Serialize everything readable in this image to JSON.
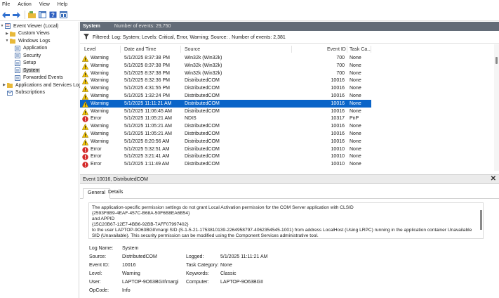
{
  "menu": [
    "File",
    "Action",
    "View",
    "Help"
  ],
  "toolbar": {
    "icons": [
      "back-arrow-icon",
      "forward-arrow-icon",
      "folder-icon",
      "console-tree-icon",
      "help-icon",
      "properties-icon"
    ]
  },
  "tree": {
    "items": [
      {
        "label": "Event Viewer (Local)",
        "icon": "event-viewer-icon"
      },
      {
        "label": "Custom Views",
        "icon": "folder-icon"
      },
      {
        "label": "Windows Logs",
        "icon": "folder-icon"
      },
      {
        "label": "Application",
        "icon": "log-icon"
      },
      {
        "label": "Security",
        "icon": "log-icon"
      },
      {
        "label": "Setup",
        "icon": "log-icon"
      },
      {
        "label": "System",
        "icon": "log-icon"
      },
      {
        "label": "Forwarded Events",
        "icon": "log-icon"
      },
      {
        "label": "Applications and Services Logs",
        "icon": "folder-icon"
      },
      {
        "label": "Subscriptions",
        "icon": "subscriptions-icon"
      }
    ]
  },
  "pane": {
    "title": "System",
    "count": "Number of events: 29,750",
    "filter": "Filtered: Log: System; Levels: Critical, Error, Warning; Source: . Number of events: 2,381"
  },
  "grid": {
    "headers": [
      "Level",
      "Date and Time",
      "Source",
      "Event ID",
      "Task Ca..."
    ],
    "rows": [
      {
        "level": "Warning",
        "date": "5/1/2025 8:37:38 PM",
        "source": "Win32k (Win32k)",
        "id": "700",
        "task": "None"
      },
      {
        "level": "Warning",
        "date": "5/1/2025 8:37:38 PM",
        "source": "Win32k (Win32k)",
        "id": "700",
        "task": "None"
      },
      {
        "level": "Warning",
        "date": "5/1/2025 8:37:38 PM",
        "source": "Win32k (Win32k)",
        "id": "700",
        "task": "None"
      },
      {
        "level": "Warning",
        "date": "5/1/2025 8:32:36 PM",
        "source": "DistributedCOM",
        "id": "10016",
        "task": "None"
      },
      {
        "level": "Warning",
        "date": "5/1/2025 4:31:55 PM",
        "source": "DistributedCOM",
        "id": "10016",
        "task": "None"
      },
      {
        "level": "Warning",
        "date": "5/1/2025 1:32:24 PM",
        "source": "DistributedCOM",
        "id": "10016",
        "task": "None"
      },
      {
        "level": "Warning",
        "date": "5/1/2025 11:11:21 AM",
        "source": "DistributedCOM",
        "id": "10016",
        "task": "None",
        "selected": true
      },
      {
        "level": "Warning",
        "date": "5/1/2025 11:06:45 AM",
        "source": "DistributedCOM",
        "id": "10016",
        "task": "None"
      },
      {
        "level": "Error",
        "date": "5/1/2025 11:05:21 AM",
        "source": "NDIS",
        "id": "10317",
        "task": "PnP"
      },
      {
        "level": "Warning",
        "date": "5/1/2025 11:05:21 AM",
        "source": "DistributedCOM",
        "id": "10016",
        "task": "None"
      },
      {
        "level": "Warning",
        "date": "5/1/2025 11:05:21 AM",
        "source": "DistributedCOM",
        "id": "10016",
        "task": "None"
      },
      {
        "level": "Warning",
        "date": "5/1/2025 8:20:56 AM",
        "source": "DistributedCOM",
        "id": "10016",
        "task": "None"
      },
      {
        "level": "Error",
        "date": "5/1/2025 5:32:51 AM",
        "source": "DistributedCOM",
        "id": "10010",
        "task": "None"
      },
      {
        "level": "Error",
        "date": "5/1/2025 3:21:41 AM",
        "source": "DistributedCOM",
        "id": "10010",
        "task": "None"
      },
      {
        "level": "Error",
        "date": "5/1/2025 1:11:49 AM",
        "source": "DistributedCOM",
        "id": "10010",
        "task": "None"
      }
    ]
  },
  "detail": {
    "title": "Event 10016, DistributedCOM",
    "close": "✕",
    "tabs": [
      "General",
      "Details"
    ],
    "message": [
      "The application-specific permission settings do not grant Local Activation permission for the COM Server application with CLSID",
      "{2593F8B9-4EAF-457C-B68A-50F6B8EA6B54}",
      " and APPID",
      "{15C20B67-12E7-4BB6-92BB-7AFF07997402}",
      " to the user LAPTOP-9O63BGII\\margi SID (S-1-5-21-1753810139-2264958797-4062354545-1001) from address LocalHost (Using LRPC) running in the application container Unavailable",
      "SID (Unavailable). This security permission can be modified using the Component Services administrative tool."
    ],
    "props": {
      "log_name_label": "Log Name:",
      "log_name": "System",
      "source_label": "Source:",
      "source": "DistributedCOM",
      "logged_label": "Logged:",
      "logged": "5/1/2025 11:11:21 AM",
      "event_id_label": "Event ID:",
      "event_id": "10016",
      "task_label": "Task Category:",
      "task": "None",
      "level_label": "Level:",
      "level": "Warning",
      "keywords_label": "Keywords:",
      "keywords": "Classic",
      "user_label": "User:",
      "user": "LAPTOP-9O63BGII\\margi",
      "computer_label": "Computer:",
      "computer": "LAPTOP-9O63BGII",
      "opcode_label": "OpCode:",
      "opcode": "Info"
    }
  },
  "colors": {
    "selection": "#0a64c8",
    "pane_header": "#636c78",
    "warning": "#f2c200",
    "error": "#d42a2a"
  }
}
